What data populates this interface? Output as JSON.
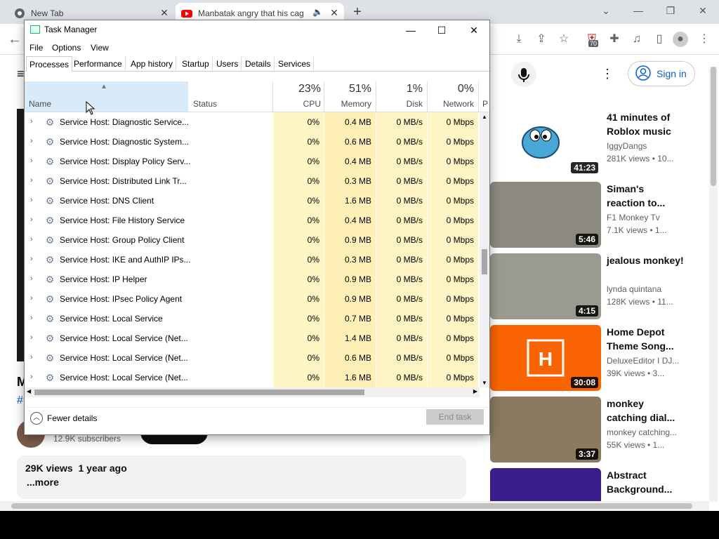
{
  "browser": {
    "tabs": [
      {
        "title": "New Tab"
      },
      {
        "title": "Manbatak angry that his cag"
      }
    ],
    "extension_badge": "70"
  },
  "youtube": {
    "sign_in": "Sign in",
    "subscribers": "12.9K subscribers",
    "views_line": "29K views  1 year ago",
    "more": "...more",
    "videos": [
      {
        "title": "41 minutes of Roblox music",
        "channel": "IggyDangs",
        "meta": "281K views  • 10...",
        "duration": "41:23",
        "thumb_color": "#ffffff"
      },
      {
        "title": "Siman's reaction to...",
        "channel": "F1 Monkey Tv",
        "meta": "7.1K views  • 1...",
        "duration": "5:46",
        "thumb_color": "#8c8a80"
      },
      {
        "title": "jealous monkey!",
        "channel": "lynda quintana",
        "meta": "128K views  • 11...",
        "duration": "4:15",
        "thumb_color": "#9a9a90"
      },
      {
        "title": "Home Depot Theme Song...",
        "channel": "DeluxeEditor I DJ...",
        "meta": "39K views  • 3...",
        "duration": "30:08",
        "thumb_color": "#f96302"
      },
      {
        "title": "monkey catching dial...",
        "channel": "monkey catching...",
        "meta": "55K views  • 1...",
        "duration": "3:37",
        "thumb_color": "#8a7a60"
      },
      {
        "title": "Abstract Background...",
        "channel": "",
        "meta": "",
        "duration": "",
        "thumb_color": "#3a1d8a"
      }
    ]
  },
  "taskmanager": {
    "title": "Task Manager",
    "menu": [
      "File",
      "Options",
      "View"
    ],
    "tabs": [
      "Processes",
      "Performance",
      "App history",
      "Startup",
      "Users",
      "Details",
      "Services"
    ],
    "columns": {
      "name": "Name",
      "status": "Status",
      "cpu": {
        "pct": "23%",
        "label": "CPU"
      },
      "memory": {
        "pct": "51%",
        "label": "Memory"
      },
      "disk": {
        "pct": "1%",
        "label": "Disk"
      },
      "network": {
        "pct": "0%",
        "label": "Network"
      },
      "power_partial": "P"
    },
    "rows": [
      {
        "name": "Service Host: Diagnostic Service...",
        "cpu": "0%",
        "mem": "0.4 MB",
        "disk": "0 MB/s",
        "net": "0 Mbps"
      },
      {
        "name": "Service Host: Diagnostic System...",
        "cpu": "0%",
        "mem": "0.6 MB",
        "disk": "0 MB/s",
        "net": "0 Mbps"
      },
      {
        "name": "Service Host: Display Policy Serv...",
        "cpu": "0%",
        "mem": "0.4 MB",
        "disk": "0 MB/s",
        "net": "0 Mbps"
      },
      {
        "name": "Service Host: Distributed Link Tr...",
        "cpu": "0%",
        "mem": "0.3 MB",
        "disk": "0 MB/s",
        "net": "0 Mbps"
      },
      {
        "name": "Service Host: DNS Client",
        "cpu": "0%",
        "mem": "1.6 MB",
        "disk": "0 MB/s",
        "net": "0 Mbps"
      },
      {
        "name": "Service Host: File History Service",
        "cpu": "0%",
        "mem": "0.4 MB",
        "disk": "0 MB/s",
        "net": "0 Mbps"
      },
      {
        "name": "Service Host: Group Policy Client",
        "cpu": "0%",
        "mem": "0.9 MB",
        "disk": "0 MB/s",
        "net": "0 Mbps"
      },
      {
        "name": "Service Host: IKE and AuthIP IPs...",
        "cpu": "0%",
        "mem": "0.3 MB",
        "disk": "0 MB/s",
        "net": "0 Mbps"
      },
      {
        "name": "Service Host: IP Helper",
        "cpu": "0%",
        "mem": "0.9 MB",
        "disk": "0 MB/s",
        "net": "0 Mbps"
      },
      {
        "name": "Service Host: IPsec Policy Agent",
        "cpu": "0%",
        "mem": "0.9 MB",
        "disk": "0 MB/s",
        "net": "0 Mbps"
      },
      {
        "name": "Service Host: Local Service",
        "cpu": "0%",
        "mem": "0.7 MB",
        "disk": "0 MB/s",
        "net": "0 Mbps"
      },
      {
        "name": "Service Host: Local Service (Net...",
        "cpu": "0%",
        "mem": "1.4 MB",
        "disk": "0 MB/s",
        "net": "0 Mbps"
      },
      {
        "name": "Service Host: Local Service (Net...",
        "cpu": "0%",
        "mem": "0.6 MB",
        "disk": "0 MB/s",
        "net": "0 Mbps"
      },
      {
        "name": "Service Host: Local Service (Net...",
        "cpu": "0%",
        "mem": "1.6 MB",
        "disk": "0 MB/s",
        "net": "0 Mbps"
      }
    ],
    "fewer_details": "Fewer details",
    "end_task": "End task"
  }
}
